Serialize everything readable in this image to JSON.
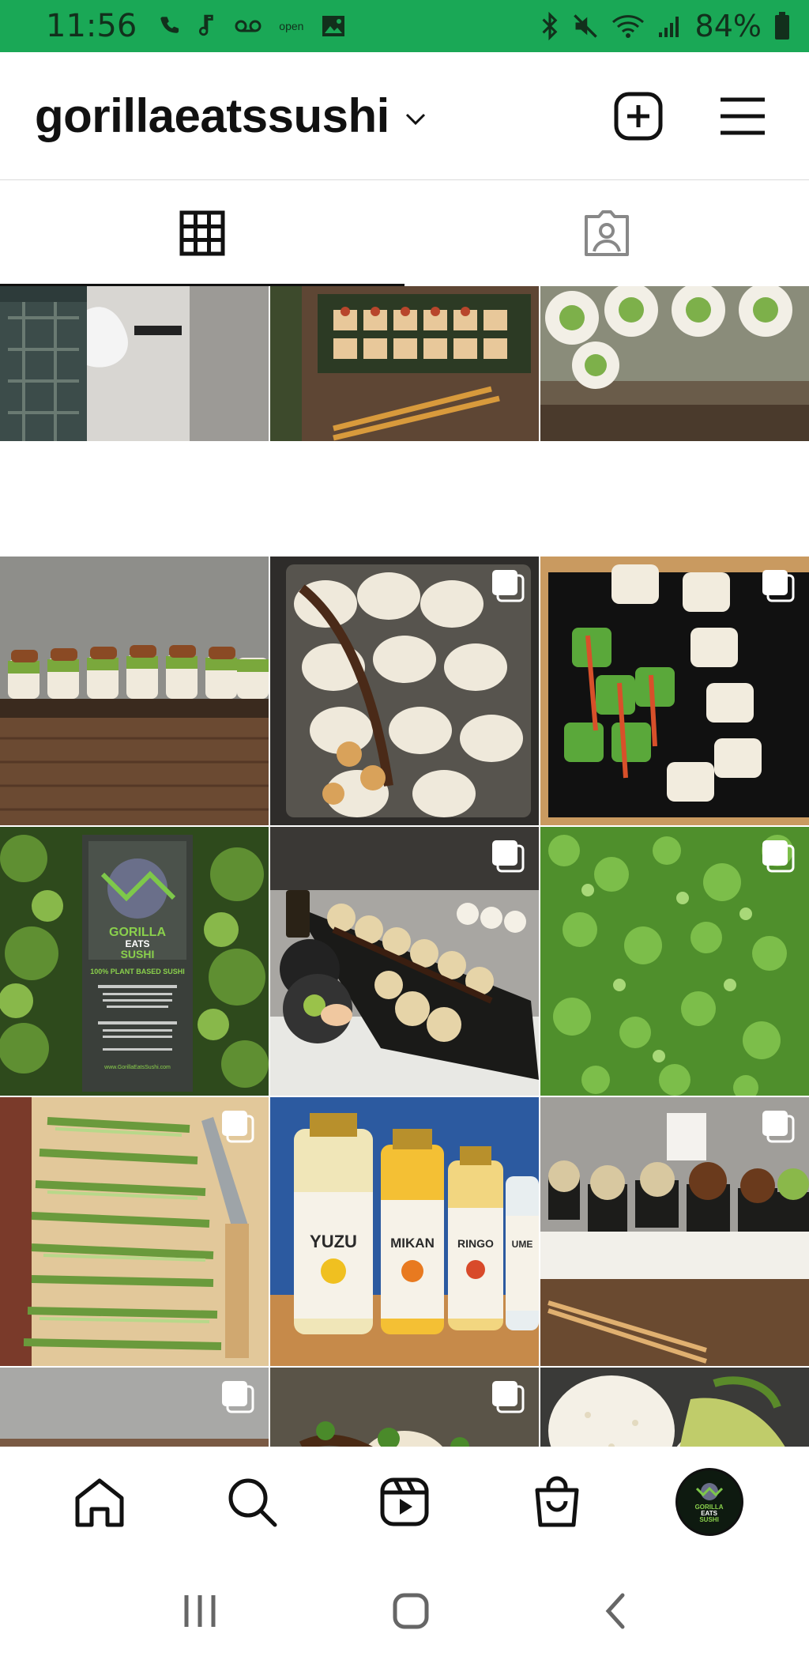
{
  "status_bar": {
    "time": "11:56",
    "open_label": "open",
    "battery": "84%",
    "bg_color": "#1aa856"
  },
  "header": {
    "username": "gorillaeatssushi",
    "icons": [
      "chevron-down-icon",
      "new-post-icon",
      "menu-icon"
    ]
  },
  "tabs": [
    {
      "name": "grid",
      "icon": "grid-icon",
      "active": true
    },
    {
      "name": "tagged",
      "icon": "tagged-user-icon",
      "active": false
    }
  ],
  "posts": [
    {
      "subject": "person holding takeout bag",
      "multi": false
    },
    {
      "subject": "sushi platter with chopsticks",
      "multi": false
    },
    {
      "subject": "avocado rolls on slate",
      "multi": false
    },
    {
      "subject": "sushi rolls lined up on board",
      "multi": false
    },
    {
      "subject": "rolls in takeout container",
      "multi": true
    },
    {
      "subject": "platter of assorted rolls",
      "multi": true
    },
    {
      "subject": "Gorilla Eats Sushi flyer in plants",
      "multi": false,
      "flyer": {
        "brand_line1": "GORILLA",
        "brand_line2": "EATS",
        "brand_line3": "SUSHI",
        "tagline": "100% PLANT BASED SUSHI",
        "website": "www.GorillaEatsSushi.com"
      }
    },
    {
      "subject": "roll plate with ginger and wasabi",
      "multi": true
    },
    {
      "subject": "chopped green onion",
      "multi": true
    },
    {
      "subject": "julienned cucumber with knife",
      "multi": true
    },
    {
      "subject": "bottled sodas",
      "multi": false,
      "bottles": [
        "YUZU",
        "MIKAN",
        "RINGO",
        "UME"
      ]
    },
    {
      "subject": "gunkan rolls with cup",
      "multi": true
    },
    {
      "subject": "knives on wood table",
      "multi": true
    },
    {
      "subject": "close-up of topped rolls",
      "multi": true
    },
    {
      "subject": "close-up of avocado roll",
      "multi": false
    }
  ],
  "bottom_nav": [
    {
      "name": "home",
      "icon": "home-icon"
    },
    {
      "name": "search",
      "icon": "search-icon"
    },
    {
      "name": "reels",
      "icon": "reels-icon"
    },
    {
      "name": "shop",
      "icon": "shop-bag-icon"
    },
    {
      "name": "profile",
      "icon": "profile-avatar",
      "avatar_text": [
        "GORILLA",
        "EATS",
        "SUSHI"
      ]
    }
  ],
  "system_nav": [
    "recent-apps-icon",
    "home-button-icon",
    "back-icon"
  ]
}
